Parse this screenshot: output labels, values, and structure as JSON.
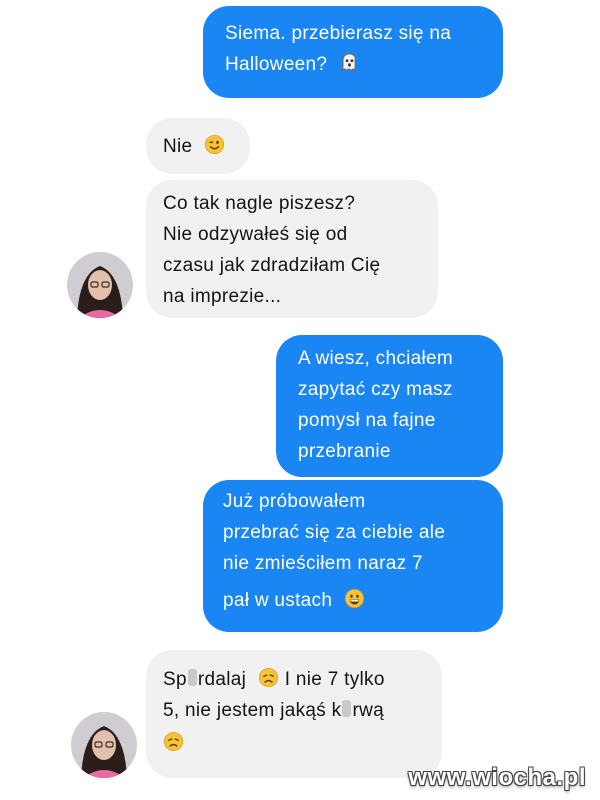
{
  "conversation": {
    "m1": {
      "l1": "Siema. przebierasz się na",
      "l2": "Halloween?"
    },
    "m2": {
      "l1": "Nie"
    },
    "m3": {
      "l1": "Co tak nagle piszesz?",
      "l2": "Nie odzywałeś się od",
      "l3": "czasu jak zdradziłam Cię",
      "l4": "na imprezie..."
    },
    "m4": {
      "l1": "A wiesz, chciałem",
      "l2": "zapytać czy masz",
      "l3": "pomysł na fajne",
      "l4": "przebranie"
    },
    "m5": {
      "l1": "Już próbowałem",
      "l2": "przebrać się za ciebie ale",
      "l3": "nie zmieściłem naraz 7",
      "l4": "pał w ustach"
    },
    "m6": {
      "l1a": "Sp",
      "l1b": "rdalaj",
      "l1c": "I nie 7 tylko",
      "l2a": "5, nie jestem jakąś k",
      "l2b": "rwą"
    }
  },
  "icons": {
    "m1_emoji": "ghost-icon",
    "m2_emoji": "winking-face-icon",
    "m5_emoji": "grinning-face-icon",
    "m6_emoji_1": "disappointed-face-icon",
    "m6_emoji_2": "disappointed-face-icon"
  },
  "colors": {
    "outgoing_bubble": "#1a86f4",
    "incoming_bubble": "#f1f1f1",
    "background": "#ffffff"
  },
  "watermark": "www.wiocha.pl"
}
